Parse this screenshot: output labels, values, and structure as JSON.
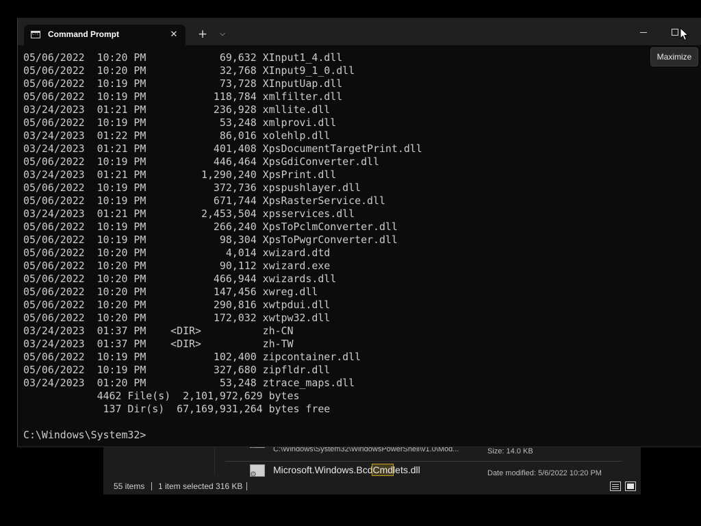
{
  "explorer": {
    "pinned_glyph": "⊤",
    "rows": [
      {
        "path": "C:\\Windows\\System32\\WindowsPowerShell\\v1.0\\Mod...",
        "meta": "Size: 14.0 KB"
      },
      {
        "name_before": "Microsoft.Windows.Bcd",
        "name_highlight": "Cmd",
        "name_after": "lets.dll",
        "meta": "Date modified: 5/6/2022 10:20 PM"
      }
    ],
    "status": {
      "items_count": "55 items",
      "selected": "1 item selected  316 KB"
    }
  },
  "terminal": {
    "tab_title": "Command Prompt",
    "tab_close_glyph": "✕",
    "new_tab_glyph": "+",
    "dropdown_glyph": "⌵",
    "lines": [
      "05/06/2022  10:20 PM            69,632 XInput1_4.dll",
      "05/06/2022  10:20 PM            32,768 XInput9_1_0.dll",
      "05/06/2022  10:19 PM            73,728 XInputUap.dll",
      "05/06/2022  10:19 PM           118,784 xmlfilter.dll",
      "03/24/2023  01:21 PM           236,928 xmllite.dll",
      "05/06/2022  10:19 PM            53,248 xmlprovi.dll",
      "03/24/2023  01:22 PM            86,016 xolehlp.dll",
      "03/24/2023  01:21 PM           401,408 XpsDocumentTargetPrint.dll",
      "05/06/2022  10:19 PM           446,464 XpsGdiConverter.dll",
      "03/24/2023  01:21 PM         1,290,240 XpsPrint.dll",
      "05/06/2022  10:19 PM           372,736 xpspushlayer.dll",
      "05/06/2022  10:19 PM           671,744 XpsRasterService.dll",
      "03/24/2023  01:21 PM         2,453,504 xpsservices.dll",
      "05/06/2022  10:19 PM           266,240 XpsToPclmConverter.dll",
      "05/06/2022  10:19 PM            98,304 XpsToPwgrConverter.dll",
      "05/06/2022  10:20 PM             4,014 xwizard.dtd",
      "05/06/2022  10:20 PM            90,112 xwizard.exe",
      "05/06/2022  10:20 PM           466,944 xwizards.dll",
      "05/06/2022  10:20 PM           147,456 xwreg.dll",
      "05/06/2022  10:20 PM           290,816 xwtpdui.dll",
      "05/06/2022  10:20 PM           172,032 xwtpw32.dll",
      "03/24/2023  01:37 PM    <DIR>          zh-CN",
      "03/24/2023  01:37 PM    <DIR>          zh-TW",
      "05/06/2022  10:19 PM           102,400 zipcontainer.dll",
      "05/06/2022  10:19 PM           327,680 zipfldr.dll",
      "03/24/2023  01:20 PM            53,248 ztrace_maps.dll",
      "            4462 File(s)  2,101,972,629 bytes",
      "             137 Dir(s)  67,169,931,264 bytes free",
      "",
      "C:\\Windows\\System32>"
    ]
  },
  "tooltip": {
    "text": "Maximize"
  },
  "colors": {
    "console_bg": "#0c0c0c",
    "console_text": "#cccccc",
    "titlebar_bg": "#202020",
    "explorer_bg": "#1c1c1c",
    "highlight": "#c9a227"
  },
  "icons": {
    "tab": "terminal-icon",
    "close": "close-icon",
    "new_tab": "plus-icon",
    "dropdown": "chevron-down-icon",
    "minimize": "minimize-icon",
    "maximize": "maximize-icon",
    "cursor": "mouse-pointer-icon",
    "file": "dll-file-icon",
    "details_view": "details-view-icon",
    "tiles_view": "large-icons-view-icon"
  }
}
